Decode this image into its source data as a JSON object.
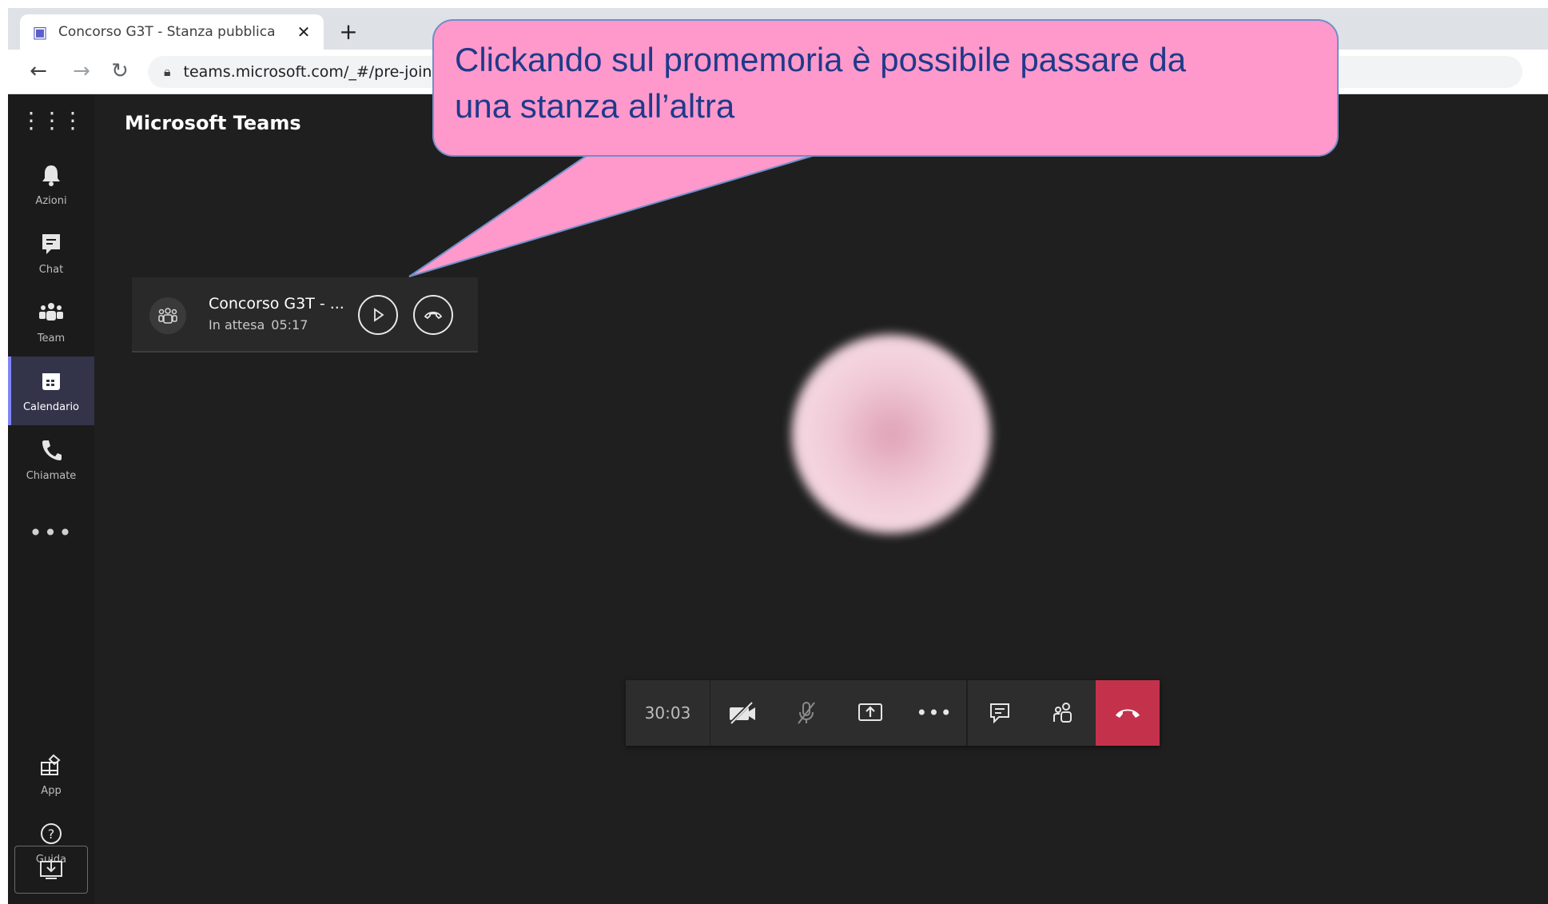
{
  "browser": {
    "tab_title": "Concorso G3T - Stanza pubblica",
    "tab_close": "✕",
    "new_tab": "+",
    "url": "teams.microsoft.com/_#/pre-join"
  },
  "app": {
    "title": "Microsoft Teams"
  },
  "rail": {
    "items": [
      {
        "label": "Azioni",
        "icon": "bell-icon"
      },
      {
        "label": "Chat",
        "icon": "chat-icon"
      },
      {
        "label": "Team",
        "icon": "teams-icon"
      },
      {
        "label": "Calendario",
        "icon": "calendar-icon",
        "active": true
      },
      {
        "label": "Chiamate",
        "icon": "phone-icon"
      }
    ],
    "more": "•••",
    "bottom_items": [
      {
        "label": "App",
        "icon": "apps-icon"
      },
      {
        "label": "Guida",
        "icon": "help-icon"
      }
    ]
  },
  "held_call": {
    "title": "Concorso G3T - ...",
    "status": "In attesa",
    "time": "05:17"
  },
  "controls": {
    "timer": "30:03"
  },
  "callout": {
    "line1": "Clickando sul promemoria è possibile passare da",
    "line2": "una stanza all’altra"
  },
  "colors": {
    "accent": "#7f85f5",
    "hangup": "#c4314b",
    "callout_fill": "#ff99cc",
    "callout_text": "#1f3a8a"
  }
}
